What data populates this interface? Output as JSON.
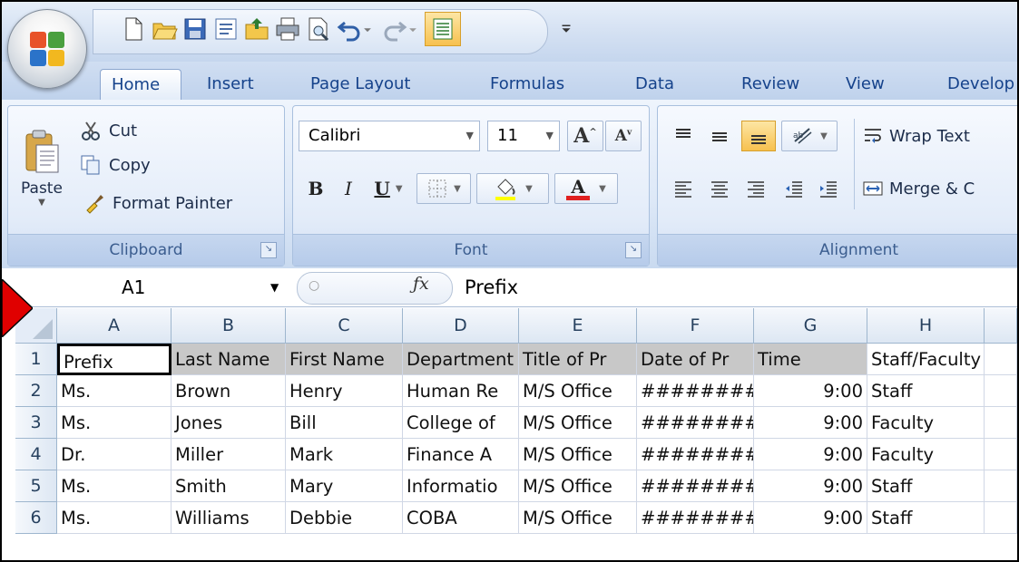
{
  "tabs": [
    "Home",
    "Insert",
    "Page Layout",
    "Formulas",
    "Data",
    "Review",
    "View",
    "Develop"
  ],
  "clipboard": {
    "group_label": "Clipboard",
    "paste": "Paste",
    "cut": "Cut",
    "copy": "Copy",
    "format_painter": "Format Painter"
  },
  "font": {
    "group_label": "Font",
    "font_name": "Calibri",
    "font_size": "11",
    "bold": "B",
    "italic": "I",
    "underline": "U",
    "font_color": "#e02020",
    "fill_color": "#ffff00"
  },
  "alignment": {
    "group_label": "Alignment",
    "wrap_text": "Wrap Text",
    "merge": "Merge & C"
  },
  "formula_bar": {
    "name_box": "A1",
    "fx": "fx",
    "content": "Prefix"
  },
  "columns": [
    "A",
    "B",
    "C",
    "D",
    "E",
    "F",
    "G",
    "H"
  ],
  "rows": [
    "1",
    "2",
    "3",
    "4",
    "5",
    "6"
  ],
  "cells": [
    [
      "Prefix",
      "Last Name",
      "First Name",
      "Department",
      "Title of Pr",
      "Date of Pr",
      "Time",
      "Staff/Faculty"
    ],
    [
      "Ms.",
      "Brown",
      "Henry",
      "Human Re",
      "M/S Office",
      "########",
      "9:00",
      "Staff"
    ],
    [
      "Ms.",
      "Jones",
      "Bill",
      "College of",
      "M/S Office",
      "########",
      "9:00",
      "Faculty"
    ],
    [
      "Dr.",
      "Miller",
      "Mark",
      "Finance A",
      "M/S Office",
      "########",
      "9:00",
      "Faculty"
    ],
    [
      "Ms.",
      "Smith",
      "Mary",
      "Informatio",
      "M/S Office",
      "########",
      "9:00",
      "Staff"
    ],
    [
      "Ms.",
      "Williams",
      "Debbie",
      "COBA",
      "M/S Office",
      "########",
      "9:00",
      "Staff"
    ]
  ],
  "colors": {
    "ribbon_text": "#15428b",
    "header_fill": "#c8c8c8",
    "arrow": "#e00000"
  }
}
